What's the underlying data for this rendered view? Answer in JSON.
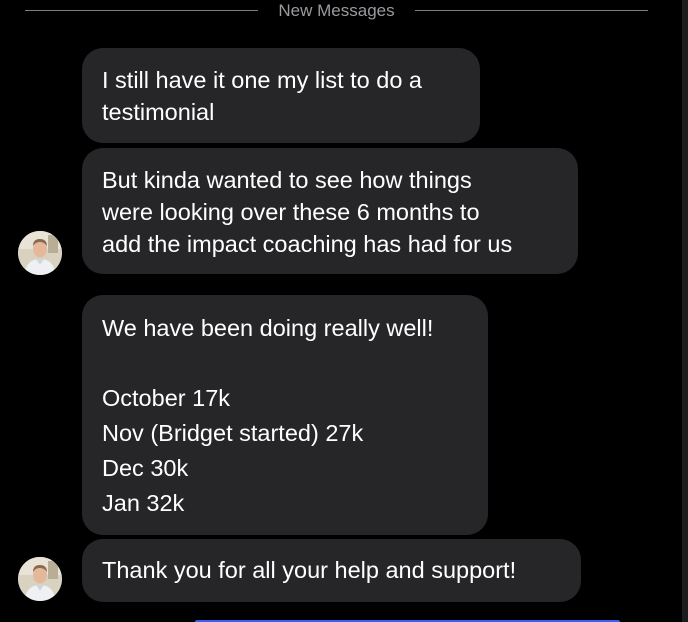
{
  "divider": {
    "label": "New Messages"
  },
  "messages": [
    {
      "lines": [
        "I still have it one my list to do a",
        "testimonial"
      ]
    },
    {
      "lines": [
        "But kinda wanted to see how things",
        "were looking over these 6 months to",
        "add the impact coaching has had for us"
      ]
    },
    {
      "lines": [
        "We have been doing really well!",
        "",
        "October 17k",
        "Nov (Bridget started) 27k",
        "Dec 30k",
        "Jan 32k"
      ]
    },
    {
      "lines": [
        "Thank you for all your help and support!"
      ]
    }
  ],
  "colors": {
    "background": "#000000",
    "bubble": "#262628",
    "text": "#ffffff",
    "divider": "#9a9a9f",
    "accent": "#3b5ff0"
  },
  "icons": {
    "avatar": "sender-avatar-photo"
  }
}
